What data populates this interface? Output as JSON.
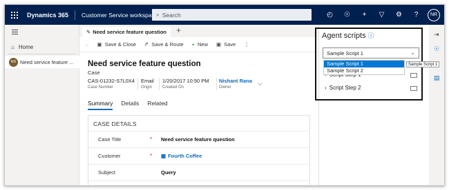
{
  "topbar": {
    "app_name": "Dynamics 365",
    "app_area": "Customer Service workspace",
    "search_placeholder": "Search",
    "avatar_initials": "NR",
    "icons": [
      "activity-icon",
      "lightbulb-icon",
      "plus-icon",
      "filter-icon",
      "settings-icon",
      "help-icon"
    ]
  },
  "leftnav": {
    "home_label": "Home",
    "case_badge": "NS",
    "case_label": "Need service feature ..."
  },
  "tabs": {
    "active_tab": "Need service feature question"
  },
  "commands": {
    "save_close": "Save & Close",
    "save_route": "Save & Route",
    "new": "New",
    "save": "Save"
  },
  "record": {
    "title": "Need service feature question",
    "type": "Case",
    "case_number": "CAS-01232-S7L0X4",
    "case_number_label": "Case Number",
    "origin": "Email",
    "origin_label": "Origin",
    "created_on": "1/20/2017 10:50 PM",
    "created_on_label": "Created On",
    "owner": "Nishant Rana",
    "owner_label": "Owner"
  },
  "form_tabs": [
    "Summary",
    "Details",
    "Related"
  ],
  "section": {
    "title": "CASE DETAILS",
    "rows": [
      {
        "label": "Case Title",
        "value": "Need service feature question",
        "required": "*"
      },
      {
        "label": "Customer",
        "value": "Fourth Coffee",
        "required": "*"
      },
      {
        "label": "Subject",
        "value": "Query",
        "required": ""
      }
    ]
  },
  "agent_scripts": {
    "title": "Agent scripts",
    "selected": "Sample Script 1",
    "options": [
      "Sample Script 1",
      "Sample Script 2"
    ],
    "tooltip": "Sample Script 1",
    "steps": [
      "Script Step 1",
      "Script Step 2"
    ]
  },
  "colors": {
    "topbar": "#002050",
    "accent": "#0f6cbd",
    "selected_option": "#0078d4",
    "required": "#c4314b"
  }
}
